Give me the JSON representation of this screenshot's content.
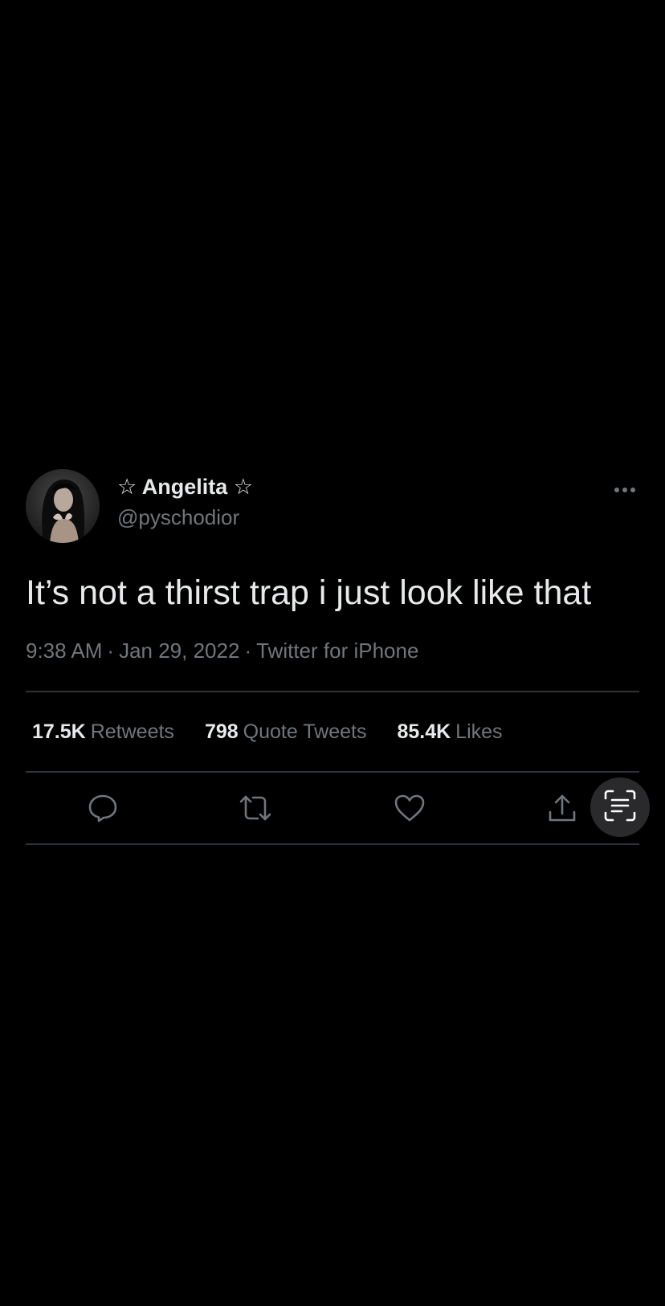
{
  "tweet": {
    "display_name": "☆ Angelita ☆",
    "handle": "@pyschodior",
    "text": "It’s not a thirst trap i just look like that",
    "time": "9:38 AM",
    "date": "Jan 29, 2022",
    "source": "Twitter for iPhone",
    "separator": "·"
  },
  "stats": {
    "retweets_count": "17.5K",
    "retweets_label": "Retweets",
    "quotes_count": "798",
    "quotes_label": "Quote Tweets",
    "likes_count": "85.4K",
    "likes_label": "Likes"
  },
  "icons": {
    "more": "more-dots-icon",
    "reply": "reply-icon",
    "retweet": "retweet-icon",
    "like": "heart-icon",
    "share": "share-icon",
    "scan": "text-scan-icon"
  },
  "colors": {
    "background": "#000000",
    "primary_text": "#e7e9ea",
    "secondary_text": "#71767b",
    "divider": "#2f3336",
    "scan_button": "#2a2a2c"
  }
}
